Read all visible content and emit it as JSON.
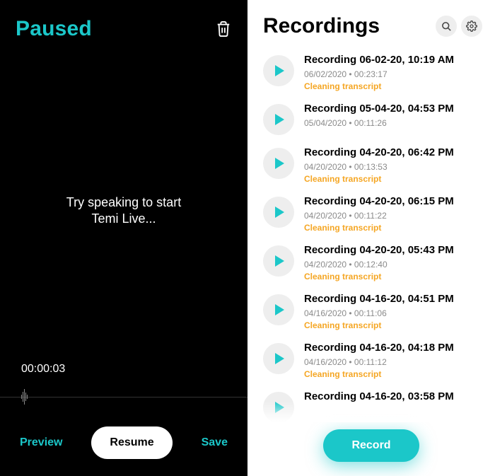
{
  "left": {
    "title": "Paused",
    "center_line1": "Try speaking to start",
    "center_line2": "Temi Live...",
    "timer": "00:00:03",
    "preview": "Preview",
    "resume": "Resume",
    "save": "Save"
  },
  "right": {
    "title": "Recordings",
    "record_button": "Record"
  },
  "recordings": [
    {
      "title": "Recording 06-02-20, 10:19 AM",
      "meta": "06/02/2020 • 00:23:17",
      "status": "Cleaning transcript"
    },
    {
      "title": "Recording 05-04-20, 04:53 PM",
      "meta": "05/04/2020 • 00:11:26",
      "status": ""
    },
    {
      "title": "Recording 04-20-20, 06:42 PM",
      "meta": "04/20/2020 • 00:13:53",
      "status": "Cleaning transcript"
    },
    {
      "title": "Recording 04-20-20, 06:15 PM",
      "meta": "04/20/2020 • 00:11:22",
      "status": "Cleaning transcript"
    },
    {
      "title": "Recording 04-20-20, 05:43 PM",
      "meta": "04/20/2020 • 00:12:40",
      "status": "Cleaning transcript"
    },
    {
      "title": "Recording 04-16-20, 04:51 PM",
      "meta": "04/16/2020 • 00:11:06",
      "status": "Cleaning transcript"
    },
    {
      "title": "Recording 04-16-20, 04:18 PM",
      "meta": "04/16/2020 • 00:11:12",
      "status": "Cleaning transcript"
    },
    {
      "title": "Recording 04-16-20, 03:58 PM",
      "meta": "",
      "status": ""
    }
  ],
  "colors": {
    "accent": "#1bc7c9",
    "status": "#f5a623"
  }
}
